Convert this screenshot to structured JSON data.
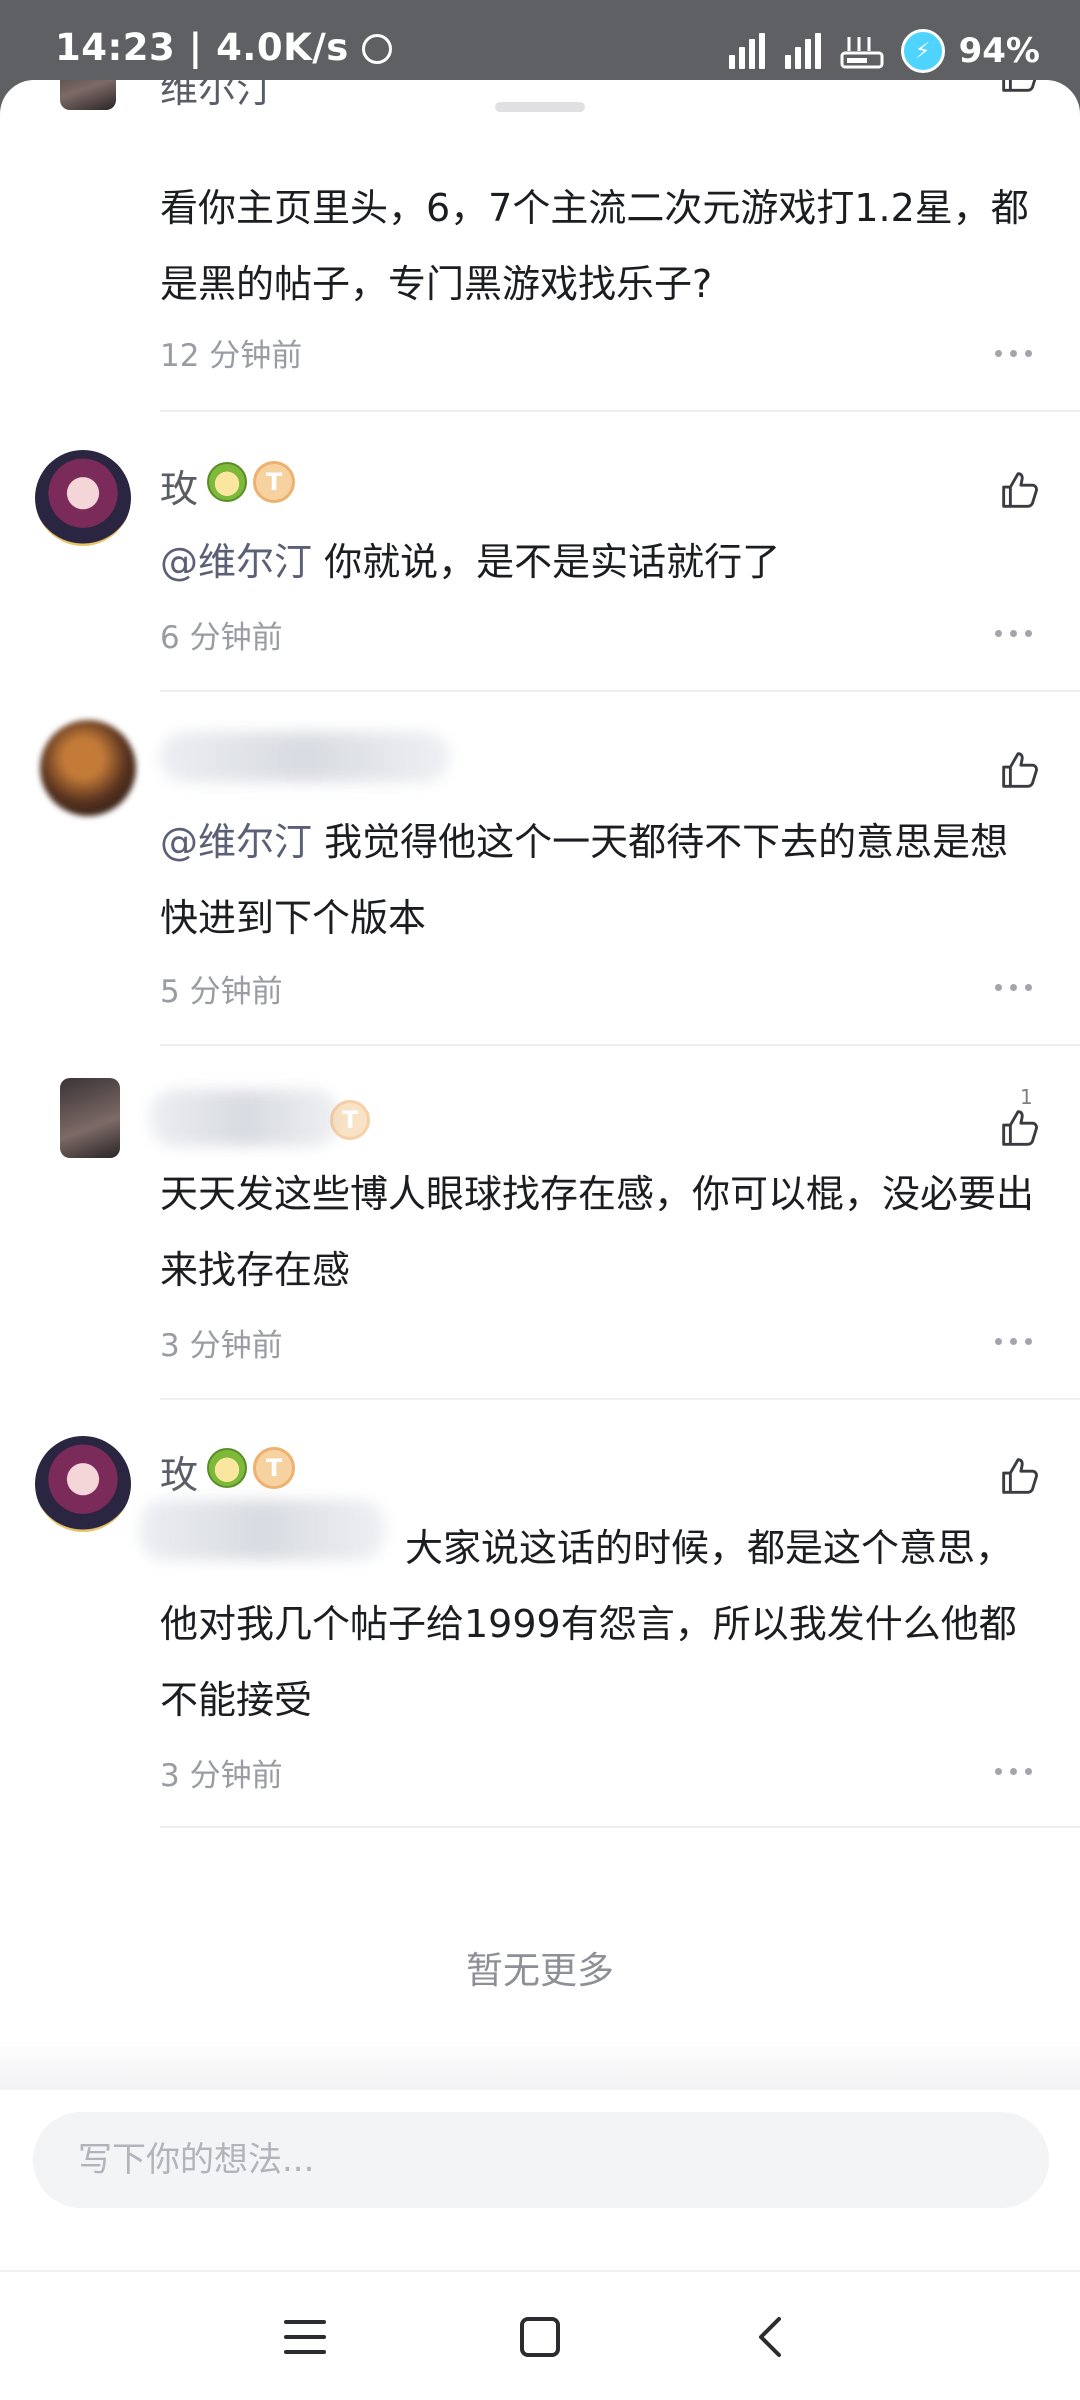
{
  "status_bar": {
    "time": "14:23",
    "speed": "4.0K/s",
    "battery_pct": "94%"
  },
  "comments": [
    {
      "name": "维尔汀",
      "text": "看你主页里头，6，7个主流二次元游戏打1.2星，都是黑的帖子，专门黑游戏找乐子?",
      "time": "12 分钟前"
    },
    {
      "name": "玫",
      "mention": "@维尔汀",
      "text": "你就说，是不是实话就行了",
      "time": "6 分钟前",
      "badge_level": "T"
    },
    {
      "mention": "@维尔汀",
      "text": "我觉得他这个一天都待不下去的意思是想快进到下个版本",
      "time": "5 分钟前"
    },
    {
      "text": "天天发这些博人眼球找存在感，你可以棍，没必要出来找存在感",
      "time": "3 分钟前",
      "likes": "1"
    },
    {
      "name": "玫",
      "text": "大家说这话的时候，都是这个意思，他对我几个帖子给1999有怨言，所以我发什么他都不能接受",
      "time": "3 分钟前",
      "badge_level": "T"
    }
  ],
  "no_more_text": "暂无更多",
  "input_placeholder": "写下你的想法..."
}
